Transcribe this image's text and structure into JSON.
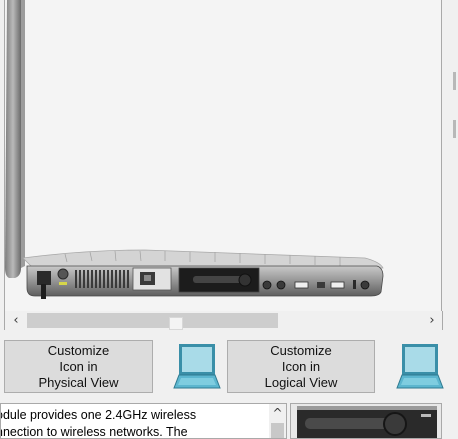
{
  "physical_button": {
    "line1": "Customize",
    "line2": "Icon in",
    "line3": "Physical View"
  },
  "logical_button": {
    "line1": "Customize",
    "line2": "Icon in",
    "line3": "Logical View"
  },
  "description": {
    "line1": "odule provides one 2.4GHz wireless",
    "line2": "nnection to wireless networks. The"
  },
  "scrollbar": {
    "left_arrow": "‹",
    "right_arrow": "›",
    "up_arrow": "^"
  },
  "colors": {
    "laptop_icon_screen": "#5cb6cf",
    "laptop_icon_body": "#3a8fa8",
    "button_bg": "#dcdcdc",
    "viewport_bg": "#f4f4f4"
  },
  "icons": {
    "device": "laptop-side-view",
    "physical_icon": "laptop-icon",
    "logical_icon": "laptop-icon"
  }
}
